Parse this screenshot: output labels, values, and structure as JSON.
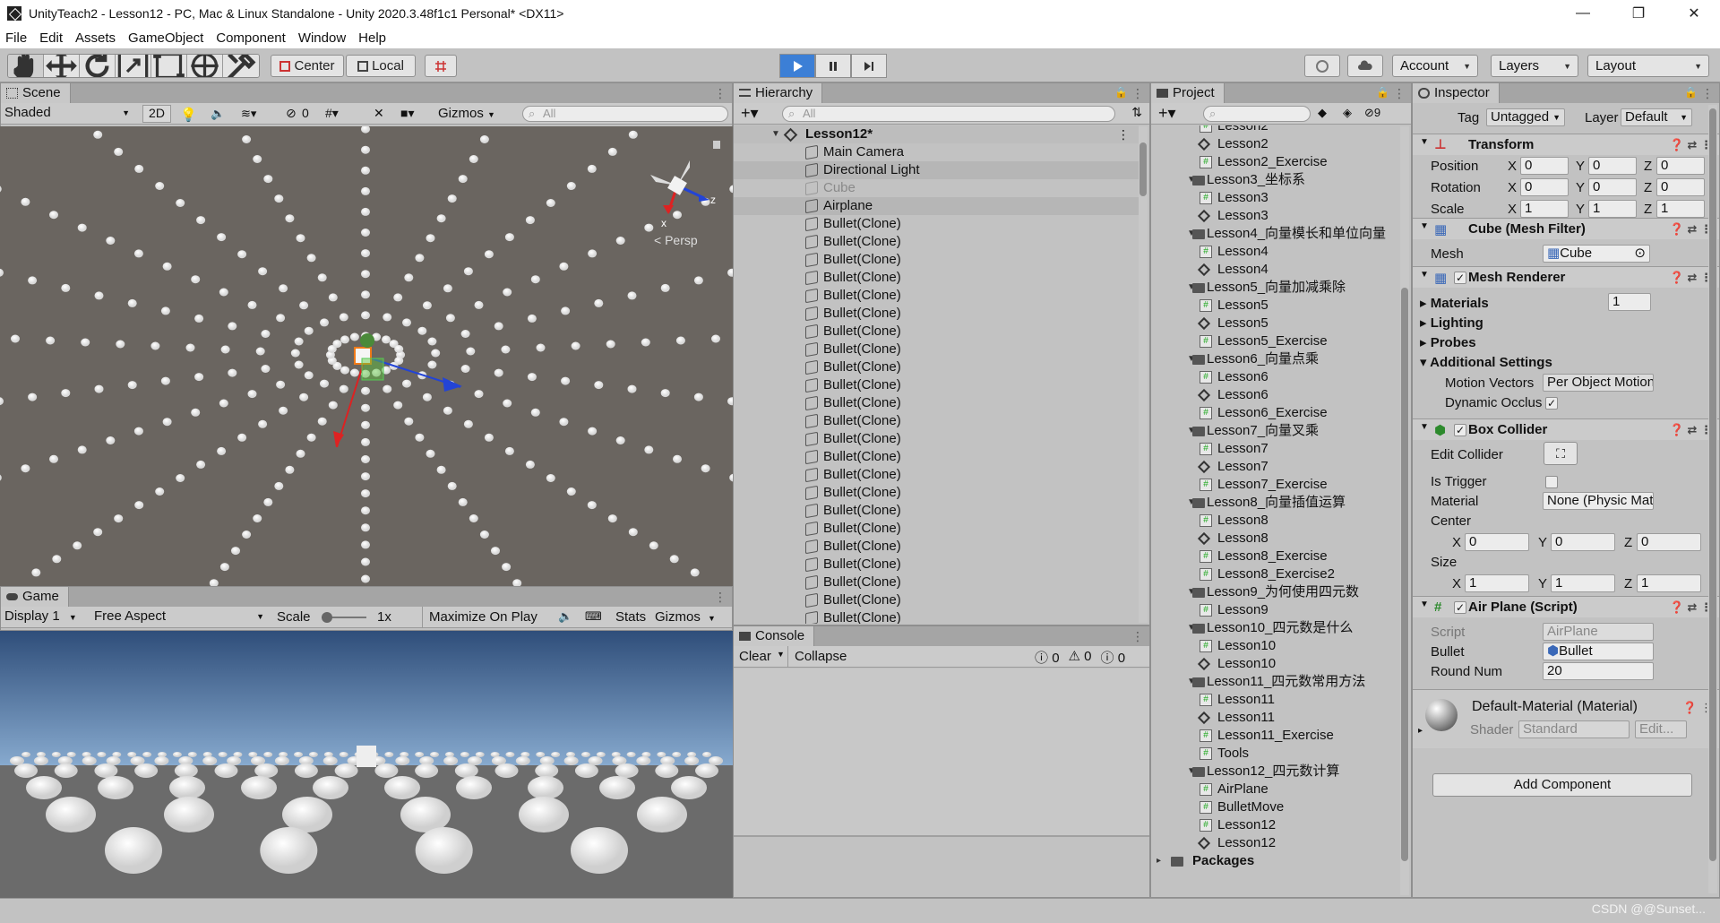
{
  "window": {
    "title": "UnityTeach2 - Lesson12 - PC, Mac & Linux Standalone - Unity 2020.3.48f1c1 Personal* <DX11>",
    "minimize": "—",
    "maximize": "❐",
    "close": "✕"
  },
  "menu": [
    "File",
    "Edit",
    "Assets",
    "GameObject",
    "Component",
    "Window",
    "Help"
  ],
  "toolbar": {
    "pivot": "Center",
    "space": "Local",
    "account": "Account",
    "layers": "Layers",
    "layout": "Layout"
  },
  "scene": {
    "tab": "Scene",
    "shading": "Shaded",
    "mode2d": "2D",
    "fx_count": "0",
    "gizmos": "Gizmos",
    "search_placeholder": "All",
    "persp": "Persp",
    "axis_x": "x",
    "axis_z": "z"
  },
  "game": {
    "tab": "Game",
    "display": "Display 1",
    "aspect": "Free Aspect",
    "scale_label": "Scale",
    "scale_value": "1x",
    "maximize": "Maximize On Play",
    "stats": "Stats",
    "gizmos": "Gizmos"
  },
  "hierarchy": {
    "tab": "Hierarchy",
    "search_placeholder": "All",
    "scene_name": "Lesson12*",
    "items": [
      {
        "label": "Main Camera",
        "state": "normal"
      },
      {
        "label": "Directional Light",
        "state": "hl"
      },
      {
        "label": "Cube",
        "state": "disabled"
      },
      {
        "label": "Airplane",
        "state": "hl"
      },
      {
        "label": "Bullet(Clone)",
        "state": "normal"
      },
      {
        "label": "Bullet(Clone)",
        "state": "normal"
      },
      {
        "label": "Bullet(Clone)",
        "state": "normal"
      },
      {
        "label": "Bullet(Clone)",
        "state": "normal"
      },
      {
        "label": "Bullet(Clone)",
        "state": "normal"
      },
      {
        "label": "Bullet(Clone)",
        "state": "normal"
      },
      {
        "label": "Bullet(Clone)",
        "state": "normal"
      },
      {
        "label": "Bullet(Clone)",
        "state": "normal"
      },
      {
        "label": "Bullet(Clone)",
        "state": "normal"
      },
      {
        "label": "Bullet(Clone)",
        "state": "normal"
      },
      {
        "label": "Bullet(Clone)",
        "state": "normal"
      },
      {
        "label": "Bullet(Clone)",
        "state": "normal"
      },
      {
        "label": "Bullet(Clone)",
        "state": "normal"
      },
      {
        "label": "Bullet(Clone)",
        "state": "normal"
      },
      {
        "label": "Bullet(Clone)",
        "state": "normal"
      },
      {
        "label": "Bullet(Clone)",
        "state": "normal"
      },
      {
        "label": "Bullet(Clone)",
        "state": "normal"
      },
      {
        "label": "Bullet(Clone)",
        "state": "normal"
      },
      {
        "label": "Bullet(Clone)",
        "state": "normal"
      },
      {
        "label": "Bullet(Clone)",
        "state": "normal"
      },
      {
        "label": "Bullet(Clone)",
        "state": "normal"
      },
      {
        "label": "Bullet(Clone)",
        "state": "normal"
      },
      {
        "label": "Bullet(Clone)",
        "state": "normal"
      },
      {
        "label": "Bullet(Clone)",
        "state": "normal"
      }
    ]
  },
  "console": {
    "tab": "Console",
    "clear": "Clear",
    "collapse": "Collapse",
    "info_count": "0",
    "warn_count": "0",
    "error_count": "0"
  },
  "project": {
    "tab": "Project",
    "hidden_count": "9",
    "items": [
      {
        "label": "Lesson2",
        "kind": "script",
        "depth": 2
      },
      {
        "label": "Lesson2",
        "kind": "scene",
        "depth": 2
      },
      {
        "label": "Lesson2_Exercise",
        "kind": "script",
        "depth": 2
      },
      {
        "label": "Lesson3_坐标系",
        "kind": "folder",
        "depth": 1
      },
      {
        "label": "Lesson3",
        "kind": "script",
        "depth": 2
      },
      {
        "label": "Lesson3",
        "kind": "scene",
        "depth": 2
      },
      {
        "label": "Lesson4_向量模长和单位向量",
        "kind": "folder",
        "depth": 1
      },
      {
        "label": "Lesson4",
        "kind": "script",
        "depth": 2
      },
      {
        "label": "Lesson4",
        "kind": "scene",
        "depth": 2
      },
      {
        "label": "Lesson5_向量加减乘除",
        "kind": "folder",
        "depth": 1
      },
      {
        "label": "Lesson5",
        "kind": "script",
        "depth": 2
      },
      {
        "label": "Lesson5",
        "kind": "scene",
        "depth": 2
      },
      {
        "label": "Lesson5_Exercise",
        "kind": "script",
        "depth": 2
      },
      {
        "label": "Lesson6_向量点乘",
        "kind": "folder",
        "depth": 1
      },
      {
        "label": "Lesson6",
        "kind": "script",
        "depth": 2
      },
      {
        "label": "Lesson6",
        "kind": "scene",
        "depth": 2
      },
      {
        "label": "Lesson6_Exercise",
        "kind": "script",
        "depth": 2
      },
      {
        "label": "Lesson7_向量叉乘",
        "kind": "folder",
        "depth": 1
      },
      {
        "label": "Lesson7",
        "kind": "script",
        "depth": 2
      },
      {
        "label": "Lesson7",
        "kind": "scene",
        "depth": 2
      },
      {
        "label": "Lesson7_Exercise",
        "kind": "script",
        "depth": 2
      },
      {
        "label": "Lesson8_向量插值运算",
        "kind": "folder",
        "depth": 1
      },
      {
        "label": "Lesson8",
        "kind": "script",
        "depth": 2
      },
      {
        "label": "Lesson8",
        "kind": "scene",
        "depth": 2
      },
      {
        "label": "Lesson8_Exercise",
        "kind": "script",
        "depth": 2
      },
      {
        "label": "Lesson8_Exercise2",
        "kind": "script",
        "depth": 2
      },
      {
        "label": "Lesson9_为何使用四元数",
        "kind": "folder",
        "depth": 1
      },
      {
        "label": "Lesson9",
        "kind": "script",
        "depth": 2
      },
      {
        "label": "Lesson10_四元数是什么",
        "kind": "folder",
        "depth": 1
      },
      {
        "label": "Lesson10",
        "kind": "script",
        "depth": 2
      },
      {
        "label": "Lesson10",
        "kind": "scene",
        "depth": 2
      },
      {
        "label": "Lesson11_四元数常用方法",
        "kind": "folder",
        "depth": 1
      },
      {
        "label": "Lesson11",
        "kind": "script",
        "depth": 2
      },
      {
        "label": "Lesson11",
        "kind": "scene",
        "depth": 2
      },
      {
        "label": "Lesson11_Exercise",
        "kind": "script",
        "depth": 2
      },
      {
        "label": "Tools",
        "kind": "script",
        "depth": 2
      },
      {
        "label": "Lesson12_四元数计算",
        "kind": "folder",
        "depth": 1
      },
      {
        "label": "AirPlane",
        "kind": "script",
        "depth": 2
      },
      {
        "label": "BulletMove",
        "kind": "script",
        "depth": 2
      },
      {
        "label": "Lesson12",
        "kind": "script",
        "depth": 2
      },
      {
        "label": "Lesson12",
        "kind": "scene",
        "depth": 2
      },
      {
        "label": "Packages",
        "kind": "folder-root",
        "depth": 0
      }
    ]
  },
  "inspector": {
    "tab": "Inspector",
    "tag_label": "Tag",
    "tag_value": "Untagged",
    "layer_label": "Layer",
    "layer_value": "Default",
    "transform": {
      "title": "Transform",
      "position": "Position",
      "rotation": "Rotation",
      "scale": "Scale",
      "pos": [
        "0",
        "0",
        "0"
      ],
      "rot": [
        "0",
        "0",
        "0"
      ],
      "scl": [
        "1",
        "1",
        "1"
      ]
    },
    "mesh_filter": {
      "title": "Cube (Mesh Filter)",
      "mesh_label": "Mesh",
      "mesh_value": "Cube"
    },
    "mesh_renderer": {
      "title": "Mesh Renderer",
      "materials": "Materials",
      "materials_count": "1",
      "lighting": "Lighting",
      "probes": "Probes",
      "additional": "Additional Settings",
      "motion_vectors": "Motion Vectors",
      "motion_value": "Per Object Motion",
      "dynamic_occlusion": "Dynamic Occlusion"
    },
    "box_collider": {
      "title": "Box Collider",
      "edit_collider": "Edit Collider",
      "is_trigger": "Is Trigger",
      "material": "Material",
      "material_value": "None (Physic Material)",
      "center": "Center",
      "center_vals": [
        "0",
        "0",
        "0"
      ],
      "size": "Size",
      "size_vals": [
        "1",
        "1",
        "1"
      ]
    },
    "airplane": {
      "title": "Air Plane (Script)",
      "script": "Script",
      "script_value": "AirPlane",
      "bullet": "Bullet",
      "bullet_value": "Bullet",
      "round_num": "Round Num",
      "round_value": "20"
    },
    "material": {
      "title": "Default-Material (Material)",
      "shader": "Shader",
      "shader_value": "Standard",
      "edit": "Edit..."
    },
    "add_component": "Add Component"
  },
  "watermark": "CSDN @@Sunset..."
}
